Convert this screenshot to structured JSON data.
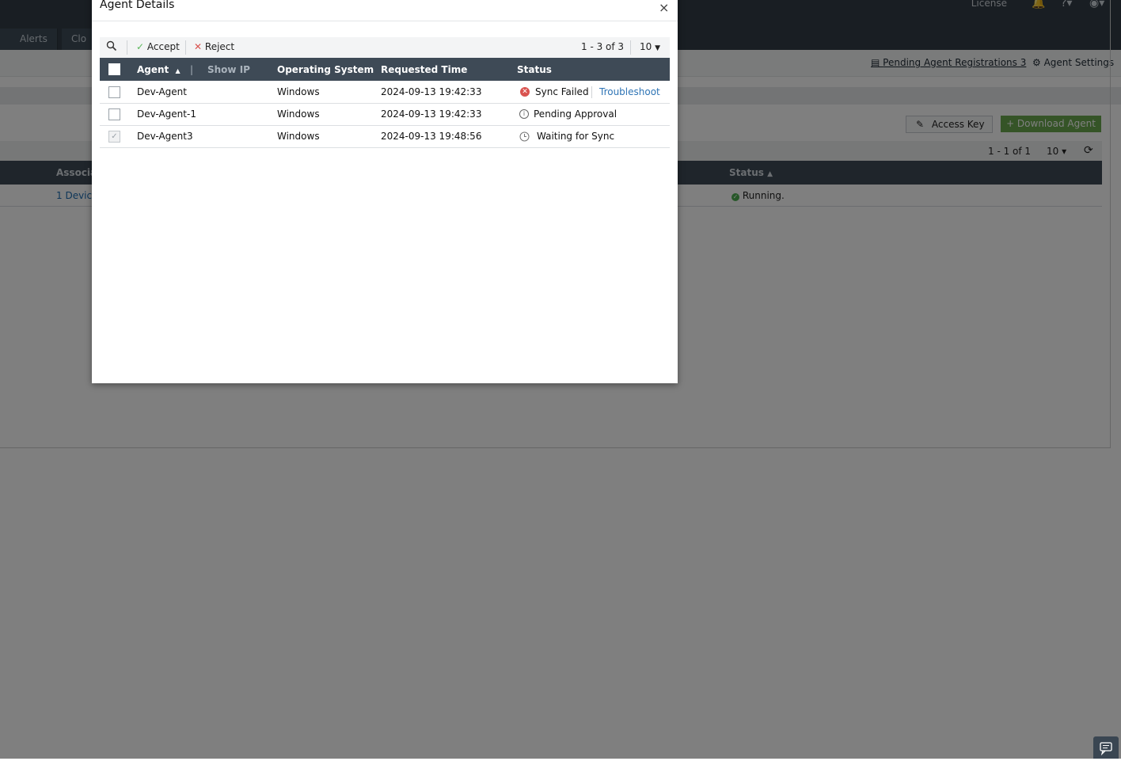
{
  "background": {
    "tabs": [
      "Alerts",
      "Clo"
    ],
    "top_links": {
      "license": "License"
    },
    "subbar": {
      "pending_link": "Pending Agent Registrations 3",
      "agent_settings": "Agent Settings"
    },
    "buttons": {
      "access_key": "Access Key",
      "download_agent": "+ Download Agent"
    },
    "pager": {
      "range": "1 - 1 of 1",
      "page_size": "10"
    },
    "table": {
      "headers": {
        "associated": "Associat",
        "status": "Status"
      },
      "row": {
        "associated": "1 Device",
        "status": "Running."
      }
    },
    "colors": {
      "success": "#4caf50",
      "primary_button": "#6aa84f"
    }
  },
  "modal": {
    "title": "Agent Details",
    "close": "×",
    "toolbar": {
      "accept": "Accept",
      "reject": "Reject",
      "range": "1 - 3 of 3",
      "page_size": "10"
    },
    "columns": {
      "agent": "Agent",
      "show_ip": "Show IP",
      "os": "Operating System",
      "requested_time": "Requested Time",
      "status": "Status"
    },
    "rows": [
      {
        "agent": "Dev-Agent",
        "os": "Windows",
        "requested_time": "2024-09-13 19:42:33",
        "status": "Sync Failed",
        "status_icon": "error-icon",
        "action": "Troubleshoot",
        "checked": false
      },
      {
        "agent": "Dev-Agent-1",
        "os": "Windows",
        "requested_time": "2024-09-13 19:42:33",
        "status": "Pending Approval",
        "status_icon": "info-icon",
        "checked": false
      },
      {
        "agent": "Dev-Agent3",
        "os": "Windows",
        "requested_time": "2024-09-13 19:48:56",
        "status": "Waiting for Sync",
        "status_icon": "clock-icon",
        "checked": true
      }
    ],
    "colors": {
      "error": "#d9534f",
      "link": "#2e74b5",
      "accept": "#5cb85c",
      "reject": "#d9534f",
      "header": "#3e4a56"
    }
  }
}
